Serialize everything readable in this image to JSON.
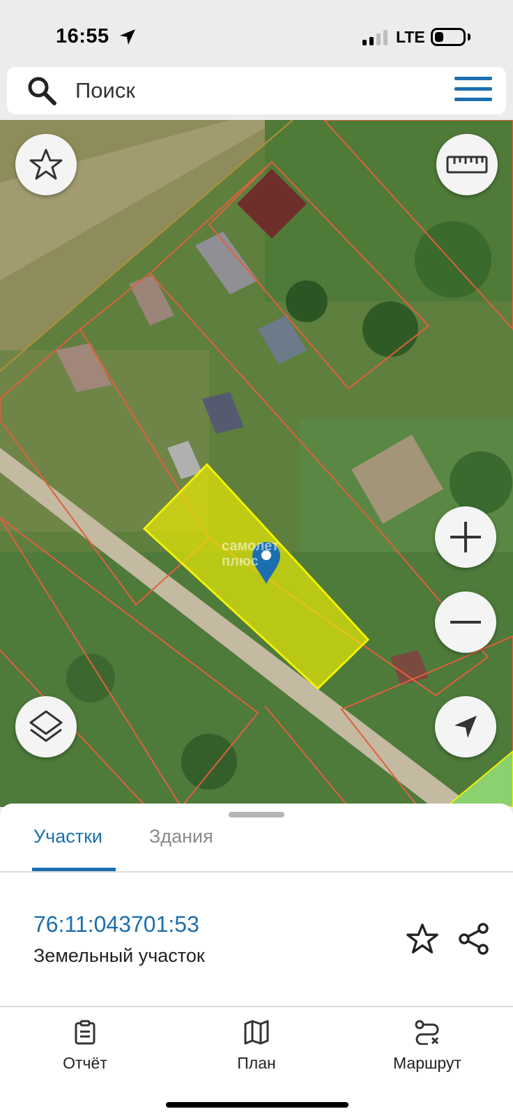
{
  "status": {
    "time": "16:55",
    "network": "LTE"
  },
  "search": {
    "placeholder": "Поиск"
  },
  "map": {
    "watermark_line1": "самолет",
    "watermark_line2": "плюс",
    "buttons": {
      "favorites": "star-icon",
      "ruler": "ruler-icon",
      "zoom_in": "plus-icon",
      "zoom_out": "minus-icon",
      "layers": "layers-icon",
      "locate": "navigation-arrow-icon"
    }
  },
  "sheet": {
    "tabs": [
      {
        "label": "Участки",
        "active": true
      },
      {
        "label": "Здания",
        "active": false
      }
    ],
    "parcel": {
      "number": "76:11:043701:53",
      "type": "Земельный участок"
    },
    "nav": [
      {
        "label": "Отчёт",
        "icon": "report-clipboard-icon"
      },
      {
        "label": "План",
        "icon": "map-plan-icon"
      },
      {
        "label": "Маршрут",
        "icon": "route-icon"
      }
    ]
  },
  "colors": {
    "accent": "#1b6fb0",
    "parcel_highlight": "#f2f200",
    "parcel_border": "#e0603c"
  }
}
